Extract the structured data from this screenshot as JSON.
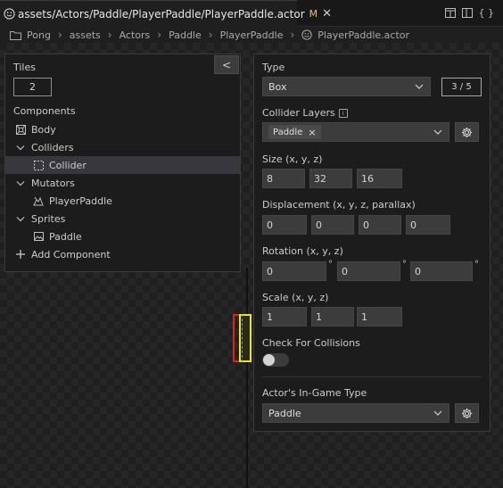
{
  "tab": {
    "title": "assets/Actors/Paddle/PlayerPaddle/PlayerPaddle.actor",
    "modified_marker": "M",
    "close_glyph": "✕",
    "actions_code_label": "{ }"
  },
  "breadcrumb": [
    "Pong",
    "assets",
    "Actors",
    "Paddle",
    "PlayerPaddle",
    "PlayerPaddle.actor"
  ],
  "left_panel": {
    "collapse_glyph": "<",
    "tiles_label": "Tiles",
    "tiles_value": "2",
    "components_label": "Components",
    "tree": [
      {
        "label": "Body",
        "icon": "body-icon"
      },
      {
        "label": "Colliders",
        "icon": "chevron-down-icon"
      },
      {
        "label": "Collider",
        "icon": "collider-icon",
        "selected": true
      },
      {
        "label": "Mutators",
        "icon": "chevron-down-icon"
      },
      {
        "label": "PlayerPaddle",
        "icon": "mutator-icon"
      },
      {
        "label": "Sprites",
        "icon": "chevron-down-icon"
      },
      {
        "label": "Paddle",
        "icon": "image-icon"
      },
      {
        "label": "Add Component",
        "icon": "plus-icon"
      }
    ]
  },
  "right_panel": {
    "type_label": "Type",
    "type_value": "Box",
    "count_badge": "3 / 5",
    "collider_layers_label": "Collider Layers",
    "collider_layers_chip": "Paddle",
    "size_label": "Size (x, y, z)",
    "size": [
      "8",
      "32",
      "16"
    ],
    "displacement_label": "Displacement (x, y, z, parallax)",
    "displacement": [
      "0",
      "0",
      "0",
      "0"
    ],
    "rotation_label": "Rotation (x, y, z)",
    "rotation": [
      "0",
      "0",
      "0"
    ],
    "degree_symbol": "°",
    "scale_label": "Scale (x, y, z)",
    "scale": [
      "1",
      "1",
      "1"
    ],
    "check_collisions_label": "Check For Collisions",
    "check_collisions_on": false,
    "in_game_type_label": "Actor's In-Game Type",
    "in_game_type_value": "Paddle",
    "info_glyph": "i"
  },
  "colors": {
    "accent_green": "#4cbf50",
    "badge_gold": "#d6a53a",
    "modified": "#e2c08d",
    "paddle_red": "#e02020",
    "paddle_yellow": "#e6e63a"
  }
}
